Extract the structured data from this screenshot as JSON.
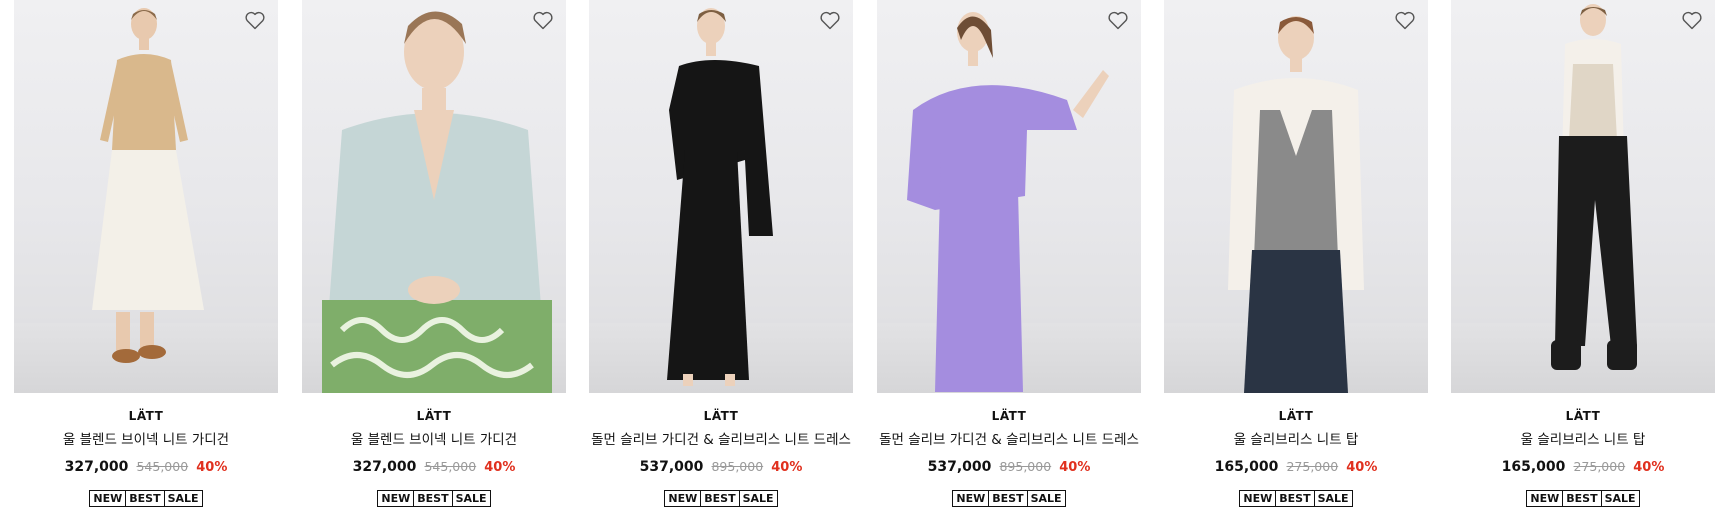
{
  "colors": {
    "sale_percent": "#e0301e",
    "original_price": "#9a9a9a",
    "photo_background": "#e9e9ec"
  },
  "icons": {
    "wishlist": "heart-outline-icon"
  },
  "products": [
    {
      "brand": "LÄTT",
      "name": "울 블렌드 브이넥 니트 가디건",
      "price": "327,000",
      "original_price": "545,000",
      "discount": "40%",
      "badges": [
        "NEW",
        "BEST",
        "SALE"
      ],
      "garment_color": "#d9b88c",
      "lower_color": "#f3f0e8"
    },
    {
      "brand": "LÄTT",
      "name": "울 블렌드 브이넥 니트 가디건",
      "price": "327,000",
      "original_price": "545,000",
      "discount": "40%",
      "badges": [
        "NEW",
        "BEST",
        "SALE"
      ],
      "garment_color": "#c5d6d6",
      "lower_color": "#7fae6a"
    },
    {
      "brand": "LÄTT",
      "name": "돌먼 슬리브 가디건 & 슬리브리스 니트 드레스",
      "price": "537,000",
      "original_price": "895,000",
      "discount": "40%",
      "badges": [
        "NEW",
        "BEST",
        "SALE"
      ],
      "garment_color": "#151515",
      "lower_color": "#151515"
    },
    {
      "brand": "LÄTT",
      "name": "돌먼 슬리브 가디건 & 슬리브리스 니트 드레스",
      "price": "537,000",
      "original_price": "895,000",
      "discount": "40%",
      "badges": [
        "NEW",
        "BEST",
        "SALE"
      ],
      "garment_color": "#a48ddf",
      "lower_color": "#a48ddf"
    },
    {
      "brand": "LÄTT",
      "name": "울 슬리브리스 니트 탑",
      "price": "165,000",
      "original_price": "275,000",
      "discount": "40%",
      "badges": [
        "NEW",
        "BEST",
        "SALE"
      ],
      "garment_color": "#8a8a8a",
      "lower_color": "#2a3444"
    },
    {
      "brand": "LÄTT",
      "name": "울 슬리브리스 니트 탑",
      "price": "165,000",
      "original_price": "275,000",
      "discount": "40%",
      "badges": [
        "NEW",
        "BEST",
        "SALE"
      ],
      "garment_color": "#e0d6c6",
      "lower_color": "#1c1c1c"
    }
  ]
}
